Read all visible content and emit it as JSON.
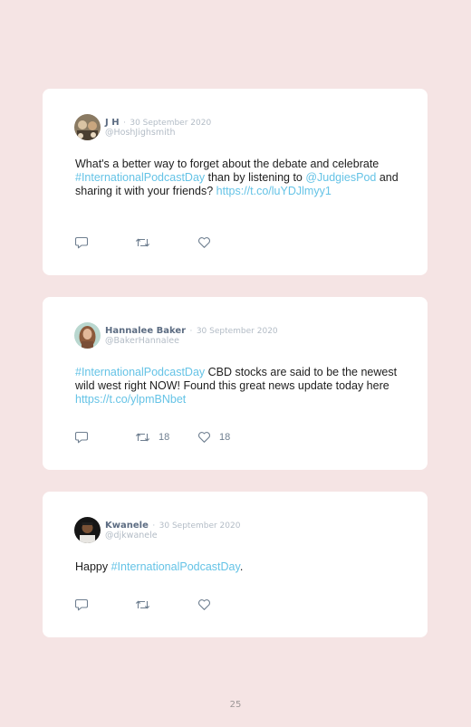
{
  "colors": {
    "page_background": "#f5e4e4",
    "card_background": "#ffffff",
    "link": "#65c3e6",
    "name": "#5c6c82",
    "meta": "#b3bcc6",
    "icon": "#6f7f90"
  },
  "tweets": [
    {
      "author": "J H",
      "date": "30 September 2020",
      "handle": "@HoshJighsmith",
      "text": {
        "t1": "What's a better way to forget about the debate and celebrate ",
        "tag": "#InternationalPodcastDay",
        "t2": " than by listening to ",
        "mention": "@JudgiesPod",
        "t3": " and sharing it with your friends? ",
        "link": "https://t.co/luYDJlmyy1"
      },
      "retweets": "",
      "likes": ""
    },
    {
      "author": "Hannalee Baker",
      "date": "30 September 2020",
      "handle": "@BakerHannalee",
      "text": {
        "tag": "#InternationalPodcastDay",
        "t1": " CBD stocks are said to be the newest wild west right NOW! Found this great news update today here ",
        "link": "https://t.co/ylpmBNbet"
      },
      "retweets": "18",
      "likes": "18"
    },
    {
      "author": "Kwanele",
      "date": "30 September 2020",
      "handle": "@djkwanele",
      "text": {
        "t1": "Happy ",
        "tag": "#InternationalPodcastDay",
        "t2": "."
      },
      "retweets": "",
      "likes": ""
    }
  ],
  "icons": {
    "reply": "reply-icon",
    "retweet": "retweet-icon",
    "like": "heart-icon"
  },
  "separator": "·",
  "page_number": "25"
}
